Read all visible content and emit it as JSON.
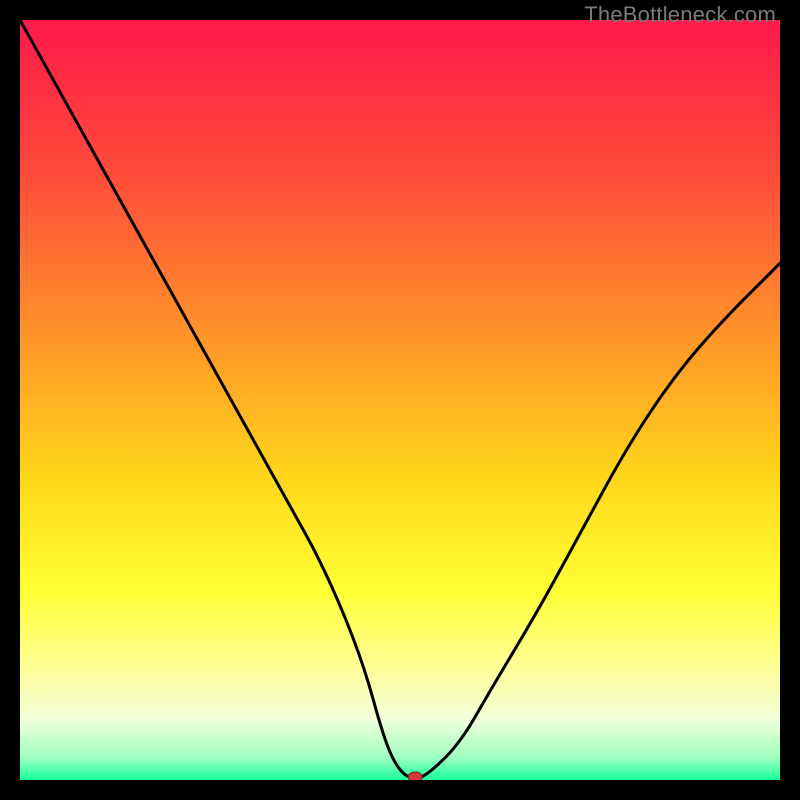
{
  "watermark": "TheBottleneck.com",
  "chart_data": {
    "type": "line",
    "title": "",
    "xlabel": "",
    "ylabel": "",
    "xlim": [
      0,
      100
    ],
    "ylim": [
      0,
      100
    ],
    "grid": false,
    "background_gradient": {
      "stops": [
        {
          "offset": 0.0,
          "color": "#ff1a4b"
        },
        {
          "offset": 0.2,
          "color": "#ff4a3a"
        },
        {
          "offset": 0.4,
          "color": "#ff8e2a"
        },
        {
          "offset": 0.6,
          "color": "#ffd61a"
        },
        {
          "offset": 0.75,
          "color": "#ffff33"
        },
        {
          "offset": 0.86,
          "color": "#ffffa0"
        },
        {
          "offset": 0.92,
          "color": "#f2ffda"
        },
        {
          "offset": 0.97,
          "color": "#9fffc0"
        },
        {
          "offset": 1.0,
          "color": "#18ff9d"
        }
      ]
    },
    "series": [
      {
        "name": "bottleneck-curve",
        "x": [
          0,
          5,
          10,
          15,
          20,
          25,
          30,
          35,
          40,
          45,
          48,
          50,
          52,
          54,
          58,
          62,
          68,
          74,
          80,
          86,
          92,
          100
        ],
        "y": [
          100,
          91,
          82,
          73,
          64,
          55,
          46,
          37,
          28,
          16,
          5,
          1,
          0,
          1,
          5,
          12,
          22,
          33,
          44,
          53,
          60,
          68
        ]
      }
    ],
    "marker": {
      "name": "optimal-point",
      "x": 52,
      "y": 0,
      "color": "#d53a3a",
      "rx": 7,
      "ry": 5
    }
  }
}
